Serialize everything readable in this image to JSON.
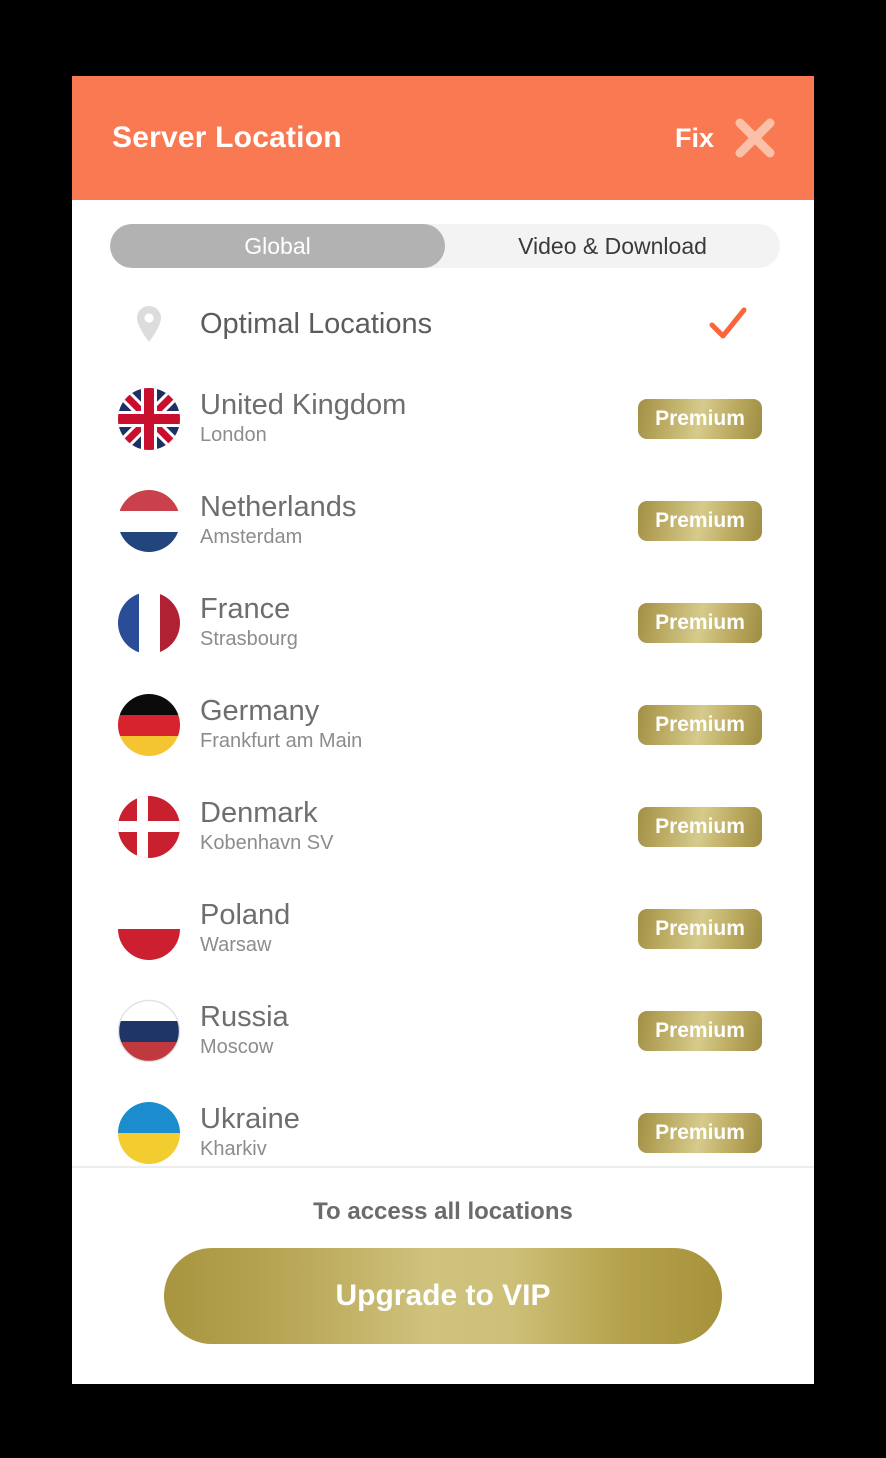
{
  "header": {
    "title": "Server Location",
    "fix_label": "Fix",
    "close_icon": "close-icon",
    "background": "#f97a52"
  },
  "tabs": [
    {
      "label": "Global",
      "active": true
    },
    {
      "label": "Video & Download",
      "active": false
    }
  ],
  "optimal": {
    "label": "Optimal Locations",
    "icon": "map-pin-icon",
    "selected": true,
    "check_icon": "check-icon",
    "check_color": "#f9663c"
  },
  "badge_label": "Premium",
  "locations": [
    {
      "country": "United Kingdom",
      "city": "London",
      "flag": "uk-flag",
      "badge": "Premium"
    },
    {
      "country": "Netherlands",
      "city": "Amsterdam",
      "flag": "netherlands-flag",
      "badge": "Premium"
    },
    {
      "country": "France",
      "city": "Strasbourg",
      "flag": "france-flag",
      "badge": "Premium"
    },
    {
      "country": "Germany",
      "city": "Frankfurt am Main",
      "flag": "germany-flag",
      "badge": "Premium"
    },
    {
      "country": "Denmark",
      "city": "Kobenhavn SV",
      "flag": "denmark-flag",
      "badge": "Premium"
    },
    {
      "country": "Poland",
      "city": "Warsaw",
      "flag": "poland-flag",
      "badge": "Premium"
    },
    {
      "country": "Russia",
      "city": "Moscow",
      "flag": "russia-flag",
      "badge": "Premium"
    },
    {
      "country": "Ukraine",
      "city": "Kharkiv",
      "flag": "ukraine-flag",
      "badge": "Premium"
    }
  ],
  "footer": {
    "note": "To access all locations",
    "cta_label": "Upgrade to VIP",
    "cta_color": "#bfae62"
  }
}
